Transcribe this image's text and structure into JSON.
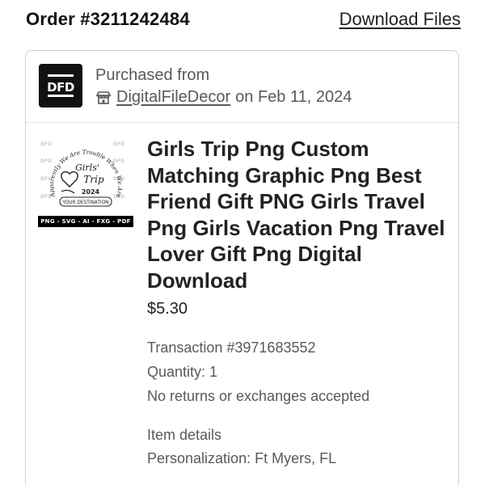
{
  "header": {
    "order_title": "Order #3211242484",
    "download_label": "Download Files"
  },
  "shop": {
    "logo_text": "DFD",
    "purchased_label": "Purchased from",
    "name": "DigitalFileDecor",
    "date_text": "on Feb 11, 2024"
  },
  "item": {
    "thumbnail": {
      "arc_text": "Apparently We Are Trouble When We Are Together",
      "heading_1": "Girls'",
      "heading_2": "Trip",
      "year": "2024",
      "destination": "YOUR DESTINATION",
      "formats": "PNG - SVG - AI - FXG - PDF",
      "watermark": "DFD"
    },
    "title": "Girls Trip Png Custom Matching Graphic Png Best Friend Gift PNG Girls Travel Png Girls Vacation Png Travel Lover Gift Png Digital Download",
    "price": "$5.30",
    "transaction": "Transaction #3971683552",
    "quantity": "Quantity: 1",
    "returns": "No returns or exchanges accepted",
    "details_label": "Item details",
    "personalization": "Personalization: Ft Myers, FL"
  },
  "icons": {
    "shop": "store-icon"
  },
  "colors": {
    "text_primary": "#222222",
    "text_secondary": "#595959",
    "border": "#cfcfcf",
    "logo_bg": "#111111"
  }
}
